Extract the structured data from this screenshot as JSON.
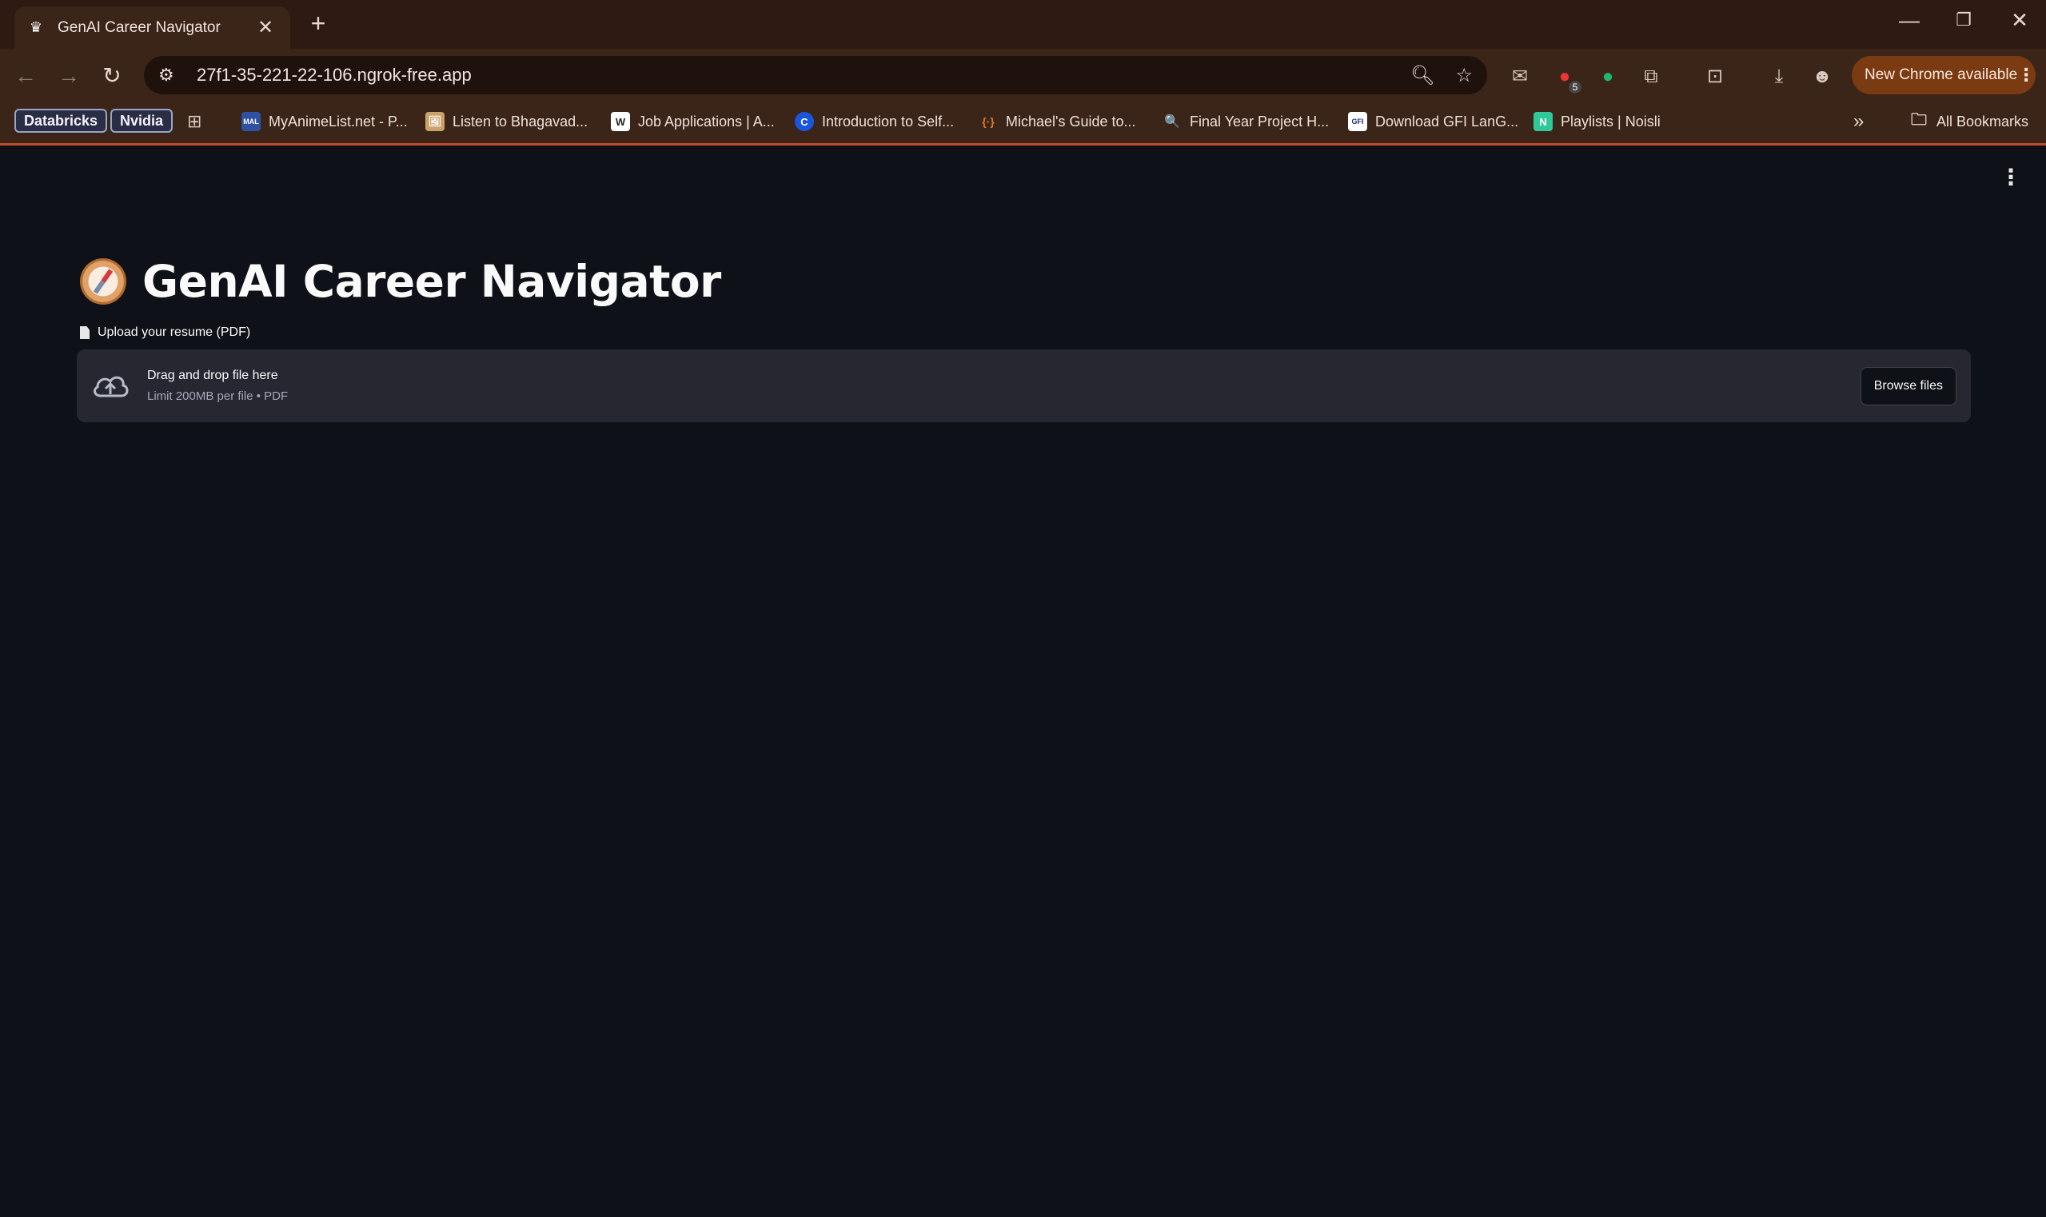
{
  "browser": {
    "tab_title": "GenAI Career Navigator",
    "tab_close": "✕",
    "new_tab": "+",
    "window_controls": {
      "minimize": "—",
      "restore": "❐",
      "close": "✕"
    },
    "url": "27f1-35-221-22-106.ngrok-free.app",
    "update_pill": "New Chrome available",
    "extension_badge": "5",
    "bookmarks": {
      "chips": [
        "Databricks",
        "Nvidia"
      ],
      "items": [
        {
          "label": "MyAnimeList.net - P...",
          "icon": "MAL"
        },
        {
          "label": "Listen to Bhagavad...",
          "icon": "🖼"
        },
        {
          "label": "Job Applications | A...",
          "icon": "W"
        },
        {
          "label": "Introduction to Self...",
          "icon": "C"
        },
        {
          "label": "Michael's Guide to...",
          "icon": "{·}"
        },
        {
          "label": "Final Year Project H...",
          "icon": "🔍"
        },
        {
          "label": "Download GFI LanG...",
          "icon": "GFI"
        },
        {
          "label": "Playlists | Noisli",
          "icon": "N"
        }
      ],
      "overflow": "»",
      "all_bookmarks": "All Bookmarks"
    }
  },
  "app": {
    "title": "GenAI Career Navigator",
    "uploader": {
      "label": "Upload your resume (PDF)",
      "drop_text": "Drag and drop file here",
      "limit_text": "Limit 200MB per file • PDF",
      "browse_label": "Browse files"
    }
  }
}
